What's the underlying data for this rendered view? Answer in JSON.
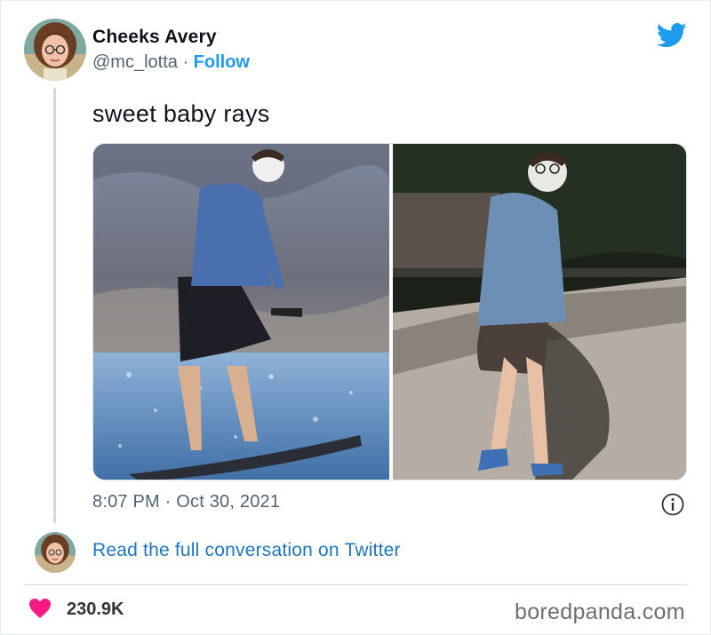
{
  "user": {
    "display_name": "Cheeks Avery",
    "handle": "@mc_lotta",
    "separator": " · ",
    "follow_label": "Follow"
  },
  "tweet": {
    "text": "sweet baby rays",
    "timestamp": "8:07 PM · Oct 30, 2021"
  },
  "footer": {
    "read_full_label": "Read the full conversation on Twitter",
    "likes_count": "230.9K",
    "watermark": "boredpanda.com"
  },
  "colors": {
    "twitter_blue": "#1d9bf0",
    "link_blue": "#1d75c4",
    "heart_pink": "#f91880",
    "secondary_text": "#536471"
  },
  "icons": [
    "twitter-bird-icon",
    "info-icon",
    "heart-icon"
  ]
}
